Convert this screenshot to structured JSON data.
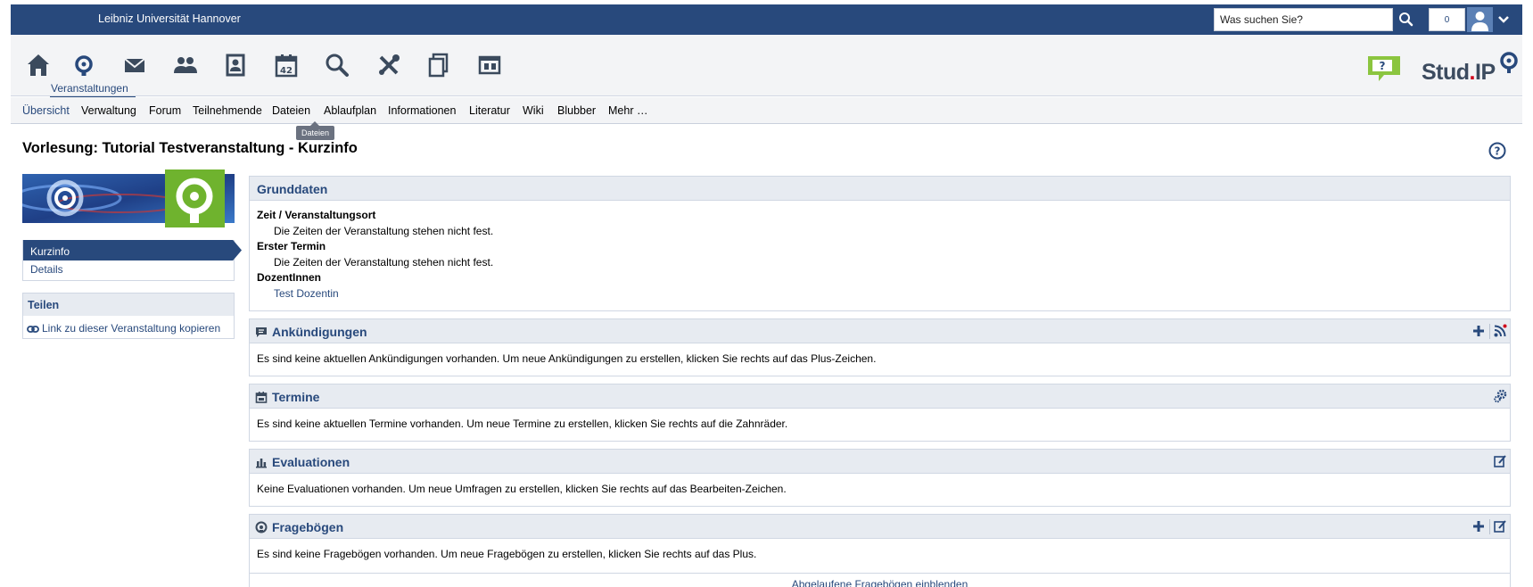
{
  "topbar": {
    "university": "Leibniz Universität Hannover",
    "search_placeholder": "Was suchen Sie?",
    "notifications": "0"
  },
  "nav": {
    "icons": [
      "home-icon",
      "courses-icon",
      "mail-icon",
      "community-icon",
      "profile-icon",
      "schedule-icon",
      "search-icon",
      "tools-icon",
      "files-icon",
      "admin-icon"
    ],
    "schedule_day": "42",
    "active_label": "Veranstaltungen"
  },
  "logo": {
    "text_main": "Stud",
    "text_dot": ".",
    "text_end": "IP"
  },
  "tabs": [
    "Übersicht",
    "Verwaltung",
    "Forum",
    "Teilnehmende",
    "Dateien",
    "Ablaufplan",
    "Informationen",
    "Literatur",
    "Wiki",
    "Blubber",
    "Mehr …"
  ],
  "tooltip": "Dateien",
  "page": {
    "title": "Vorlesung: Tutorial Testveranstaltung - Kurzinfo"
  },
  "sidebar": {
    "nav_items": [
      "Kurzinfo",
      "Details"
    ],
    "share_title": "Teilen",
    "share_link": "Link zu dieser Veranstaltung kopieren"
  },
  "grunddaten": {
    "title": "Grunddaten",
    "rows": [
      {
        "label": "Zeit / Veranstaltungsort",
        "value": "Die Zeiten der Veranstaltung stehen nicht fest."
      },
      {
        "label": "Erster Termin",
        "value": "Die Zeiten der Veranstaltung stehen nicht fest."
      },
      {
        "label": "DozentInnen",
        "value": "Test Dozentin"
      }
    ]
  },
  "sections": {
    "announcements": {
      "title": "Ankündigungen",
      "text": "Es sind keine aktuellen Ankündigungen vorhanden. Um neue Ankündigungen zu erstellen, klicken Sie rechts auf das Plus-Zeichen."
    },
    "dates": {
      "title": "Termine",
      "text": "Es sind keine aktuellen Termine vorhanden. Um neue Termine zu erstellen, klicken Sie rechts auf die Zahnräder."
    },
    "evaluations": {
      "title": "Evaluationen",
      "text": "Keine Evaluationen vorhanden. Um neue Umfragen zu erstellen, klicken Sie rechts auf das Bearbeiten-Zeichen."
    },
    "questionnaires": {
      "title": "Fragebögen",
      "text": "Es sind keine Fragebögen vorhanden. Um neue Fragebögen zu erstellen, klicken Sie rechts auf das Plus.",
      "expired_link": "Abgelaufene Fragebögen einblenden"
    }
  },
  "colors": {
    "brand_blue": "#28497c",
    "header_bg": "#e7ebf1",
    "accent_green": "#8bc53f",
    "logo_red": "#d0021b"
  }
}
